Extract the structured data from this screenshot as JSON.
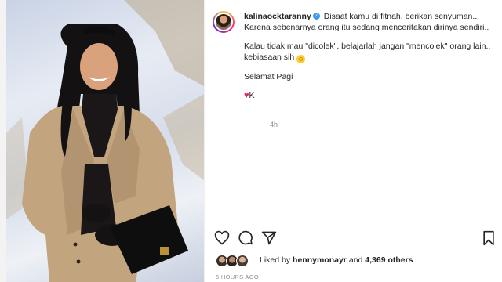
{
  "post": {
    "username": "kalinaocktaranny",
    "caption_lines": [
      "Disaat kamu di fitnah, berikan senyuman..",
      "Karena sebenarnya orang itu sedang menceritakan dirinya sendiri..",
      "Kalau tidak mau \"dicolek\", belajarlah jangan \"mencolek\" orang lain..",
      "kebiasaan sih",
      "Selamat Pagi",
      "K"
    ],
    "time_ago": "4h"
  },
  "likes": {
    "prefix": "Liked by",
    "user": "hennymonayr",
    "joiner": "and",
    "others": "4,369 others"
  },
  "posted_ago": "5 HOURS AGO",
  "colors": {
    "verified": "#3897f0",
    "heart": "#e0245e",
    "text": "#262626",
    "muted": "#8e8e8e"
  },
  "icons": [
    "heart-icon",
    "comment-icon",
    "share-icon",
    "bookmark-icon",
    "verified-icon",
    "smile-emoji-icon"
  ]
}
